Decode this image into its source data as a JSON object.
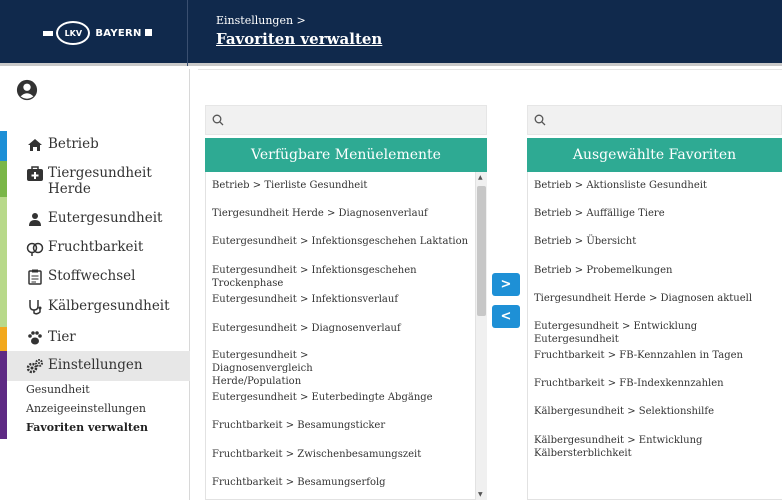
{
  "header": {
    "logo_lkv": "LKV",
    "logo_bayern": "BAYERN",
    "breadcrumb": "Einstellungen >",
    "title": "Favoriten verwalten"
  },
  "sidebar": {
    "items": [
      {
        "label": "Betrieb",
        "icon": "house-icon",
        "bar_color": "#1d8fd6"
      },
      {
        "label": "Tiergesundheit Herde",
        "icon": "first-aid-icon",
        "bar_color": "#7ab648"
      },
      {
        "label": "Eutergesundheit",
        "icon": "udder-icon",
        "bar_color": "#7ab648"
      },
      {
        "label": "Fruchtbarkeit",
        "icon": "fertility-icon",
        "bar_color": "#7ab648"
      },
      {
        "label": "Stoffwechsel",
        "icon": "clipboard-icon",
        "bar_color": "#7ab648"
      },
      {
        "label": "Kälbergesundheit",
        "icon": "stethoscope-icon",
        "bar_color": "#7ab648"
      },
      {
        "label": "Tier",
        "icon": "paw-icon",
        "bar_color": "#f2a81d"
      },
      {
        "label": "Einstellungen",
        "icon": "gears-icon",
        "bar_color": "#5e2a84"
      }
    ],
    "sub_items": [
      "Gesundheit",
      "Anzeigeeinstellungen",
      "Favoriten verwalten"
    ],
    "active_sub": "Favoriten verwalten"
  },
  "available": {
    "title": "Verfügbare Menüelemente",
    "search_placeholder": "",
    "items": [
      "Betrieb > Tierliste Gesundheit",
      "Tiergesundheit Herde > Diagnosenverlauf",
      "Eutergesundheit > Infektionsgeschehen Laktation",
      "Eutergesundheit > Infektionsgeschehen Trockenphase",
      "Eutergesundheit > Infektionsverlauf",
      "Eutergesundheit > Diagnosenverlauf",
      "Eutergesundheit > Diagnosenvergleich Herde/Population",
      "Eutergesundheit > Euterbedingte Abgänge",
      "Fruchtbarkeit > Besamungsticker",
      "Fruchtbarkeit > Zwischenbesamungszeit",
      "Fruchtbarkeit > Besamungserfolg"
    ]
  },
  "selected": {
    "title": "Ausgewählte Favoriten",
    "search_placeholder": "",
    "items": [
      "Betrieb > Aktionsliste Gesundheit",
      "Betrieb > Auffällige Tiere",
      "Betrieb > Übersicht",
      "Betrieb > Probemelkungen",
      "Tiergesundheit Herde > Diagnosen aktuell",
      "Eutergesundheit > Entwicklung Eutergesundheit",
      "Fruchtbarkeit > FB-Kennzahlen in Tagen",
      "Fruchtbarkeit > FB-Indexkennzahlen",
      "Kälbergesundheit > Selektionshilfe",
      "Kälbergesundheit > Entwicklung Kälbersterblichkeit"
    ]
  },
  "buttons": {
    "add": ">",
    "remove": "<"
  },
  "colors": {
    "header_bg": "#10294c",
    "panel_head": "#2eaa93",
    "arrow_button": "#1e90d6"
  }
}
